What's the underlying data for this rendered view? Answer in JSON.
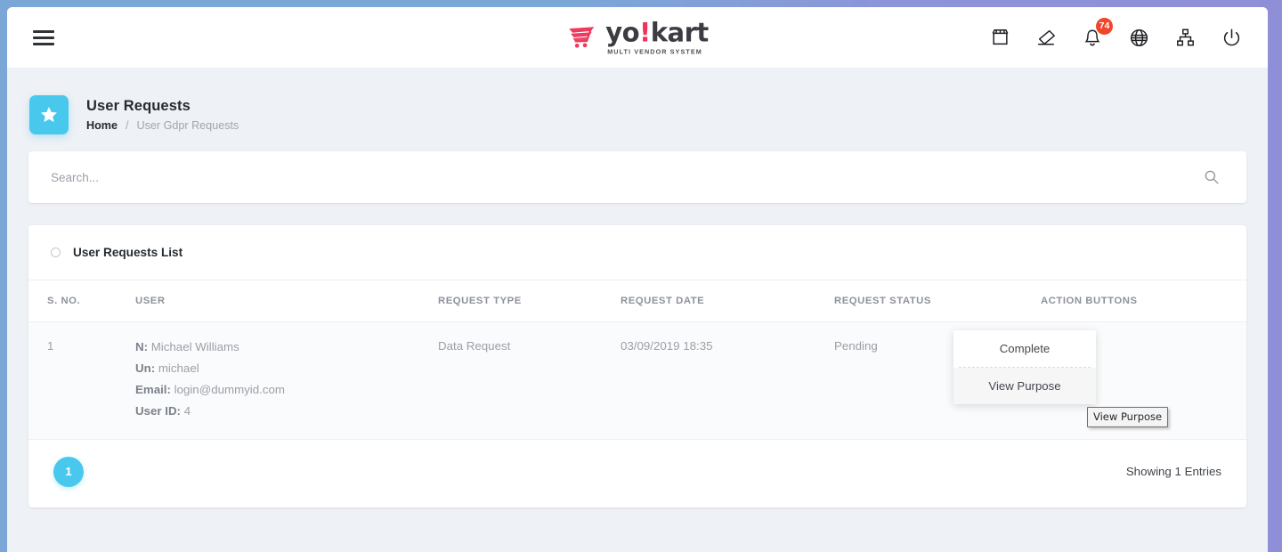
{
  "header": {
    "menu_icon": "hamburger-icon",
    "logo": {
      "word_a": "yo",
      "bang": "!",
      "word_b": "kart",
      "tagline": "MULTI VENDOR SYSTEM"
    },
    "icons": [
      {
        "name": "store-icon",
        "label": "Store"
      },
      {
        "name": "eraser-icon",
        "label": "Clear Cache"
      },
      {
        "name": "bell-icon",
        "label": "Notifications",
        "badge": "74"
      },
      {
        "name": "globe-icon",
        "label": "Language"
      },
      {
        "name": "sitemap-icon",
        "label": "Site Map"
      },
      {
        "name": "power-icon",
        "label": "Logout"
      }
    ]
  },
  "page": {
    "title": "User Requests",
    "breadcrumb": {
      "home": "Home",
      "separator": "/",
      "current": "User Gdpr Requests"
    },
    "icon": "star-icon"
  },
  "search": {
    "placeholder": "Search...",
    "value": "",
    "icon": "search-icon"
  },
  "list": {
    "title": "User Requests List",
    "columns": [
      "S. NO.",
      "USER",
      "REQUEST TYPE",
      "REQUEST DATE",
      "REQUEST STATUS",
      "ACTION BUTTONS"
    ],
    "rows": [
      {
        "sno": "1",
        "user": {
          "name_label": "N:",
          "name_value": "Michael Williams",
          "username_label": "Un:",
          "username_value": "michael",
          "email_label": "Email:",
          "email_value": "login@dummyid.com",
          "userid_label": "User ID:",
          "userid_value": "4"
        },
        "request_type": "Data Request",
        "request_date": "03/09/2019 18:35",
        "request_status": "Pending"
      }
    ],
    "dropdown": {
      "items": [
        {
          "label": "Complete",
          "active": false
        },
        {
          "label": "View Purpose",
          "active": true
        }
      ]
    },
    "tooltip": "View Purpose",
    "footer": {
      "page_number": "1",
      "entries_text": "Showing 1 Entries"
    }
  },
  "colors": {
    "accent": "#49c8ee",
    "badge": "#f3442c",
    "logo_accent": "#f0325a",
    "page_bg": "#eef1f5",
    "row_bg": "#fafbfc"
  }
}
